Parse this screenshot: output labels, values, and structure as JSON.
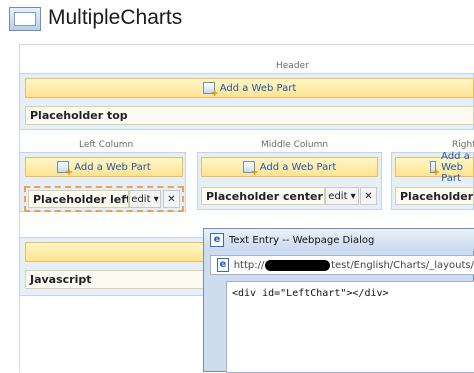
{
  "page": {
    "title": "MultipleCharts"
  },
  "header_zone": {
    "label": "Header",
    "add_web_part": "Add a Web Part",
    "placeholder": "Placeholder top"
  },
  "left_column": {
    "label": "Left Column",
    "add_web_part": "Add a Web Part",
    "placeholder": "Placeholder left",
    "edit": "edit ▾",
    "close": "✕"
  },
  "middle_column": {
    "label": "Middle Column",
    "add_web_part": "Add a Web Part",
    "placeholder": "Placeholder center",
    "edit": "edit ▾",
    "close": "✕"
  },
  "right_column": {
    "label": "Right",
    "add_web_part": "Add a Web Part",
    "placeholder": "Placeholder ri"
  },
  "bottom_zone": {
    "placeholder": "Javascript"
  },
  "dialog": {
    "title": "Text Entry -- Webpage Dialog",
    "url_prefix": "http://",
    "url_suffix": "test/English/Charts/_layouts/",
    "content": "<div id=\"LeftChart\"></div>"
  }
}
